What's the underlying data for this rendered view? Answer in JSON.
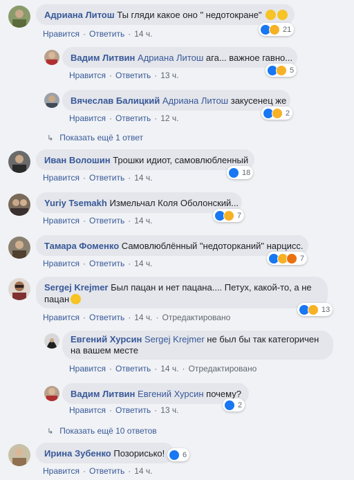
{
  "labels": {
    "like": "Нравится",
    "reply": "Ответить",
    "edited": "Отредактировано"
  },
  "comments": [
    {
      "author": "Адриана Литош",
      "text": "Ты гляди какое оно \" недотокране\"",
      "time": "14 ч.",
      "reactions": "21"
    },
    {
      "author": "Вадим Литвин",
      "mention": "Адриана Литош",
      "text": "ага... важное гавно...",
      "time": "13 ч.",
      "reactions": "5"
    },
    {
      "author": "Вячеслав Балицкий",
      "mention": "Адриана Литош",
      "text": "закусенец же",
      "time": "12 ч.",
      "reactions": "2"
    },
    {
      "author": "Иван Волошин",
      "text": "Трошки идиот, самовлюбленный",
      "time": "14 ч.",
      "reactions": "18"
    },
    {
      "author": "Yuriy Tsemakh",
      "text": "Измельчал Коля Оболонский...",
      "time": "14 ч.",
      "reactions": "7"
    },
    {
      "author": "Тамара Фоменко",
      "text": "Самовлюблённый \"недоторканий\" нарцисс.",
      "time": "14 ч.",
      "reactions": "7"
    },
    {
      "author": "Sergej Krejmer",
      "text": "Был пацан и нет пацана.... Петух, какой-то, а не пацан",
      "time": "14 ч.",
      "reactions": "13"
    },
    {
      "author": "Евгений Хурсин",
      "mention": "Sergej Krejmer",
      "text": "не был бы так категоричен на вашем месте",
      "time": "14 ч."
    },
    {
      "author": "Вадим Литвин",
      "mention": "Евгений Хурсин",
      "text": "почему?",
      "time": "13 ч.",
      "reactions": "2"
    },
    {
      "author": "Ирина Зубенко",
      "text": "Позорисько!",
      "time": "14 ч.",
      "reactions": "6"
    }
  ],
  "more_replies": [
    "Показать ещё 1 ответ",
    "Показать ещё 10 ответов"
  ],
  "colors": {
    "link": "#385898",
    "bubble": "#e4e6eb",
    "like": "#1877f2",
    "haha": "#f7b125",
    "angry": "#e9710f"
  }
}
